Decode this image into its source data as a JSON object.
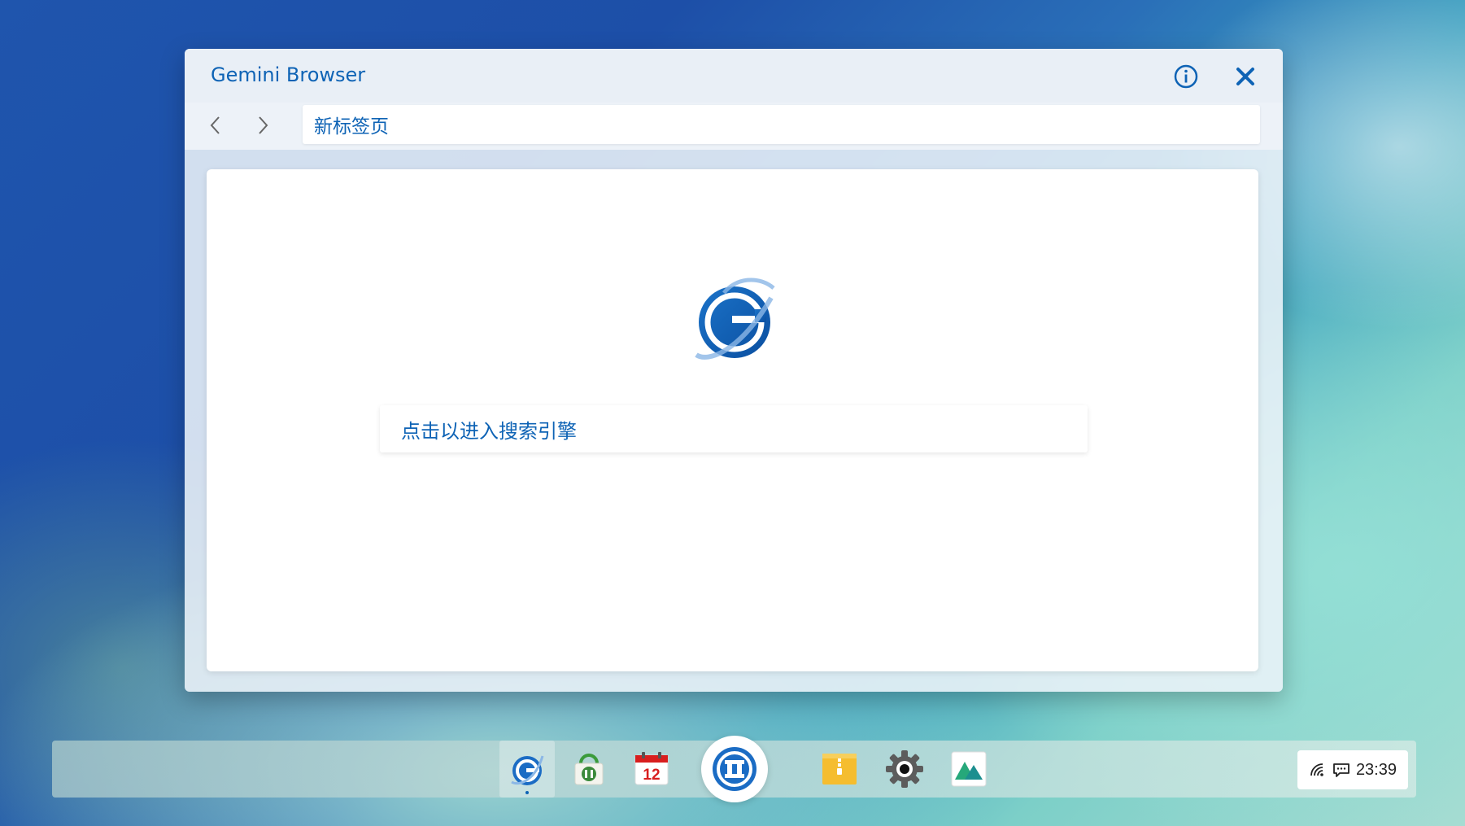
{
  "window": {
    "title": "Gemini Browser",
    "address_bar": "新标签页"
  },
  "page": {
    "search_prompt": "点击以进入搜索引擎"
  },
  "icons": {
    "info": "info-icon",
    "close": "close-icon",
    "back": "chevron-left-icon",
    "forward": "chevron-right-icon"
  },
  "taskbar": {
    "apps": [
      {
        "name": "gemini-browser",
        "icon": "browser-icon",
        "active": true
      },
      {
        "name": "app-store",
        "icon": "store-bag-icon",
        "active": false
      },
      {
        "name": "calendar",
        "icon": "calendar-icon",
        "label": "12",
        "active": false
      },
      {
        "name": "home",
        "icon": "home-logo-icon",
        "active": false
      },
      {
        "name": "archive",
        "icon": "archive-icon",
        "active": false
      },
      {
        "name": "settings",
        "icon": "gear-icon",
        "active": false
      },
      {
        "name": "gallery",
        "icon": "mountain-icon",
        "active": false
      }
    ],
    "tray": {
      "clock": "23:39"
    }
  },
  "colors": {
    "accent": "#0e63b5",
    "window_bg": "#e9eff6",
    "content_bg": "#ffffff"
  }
}
